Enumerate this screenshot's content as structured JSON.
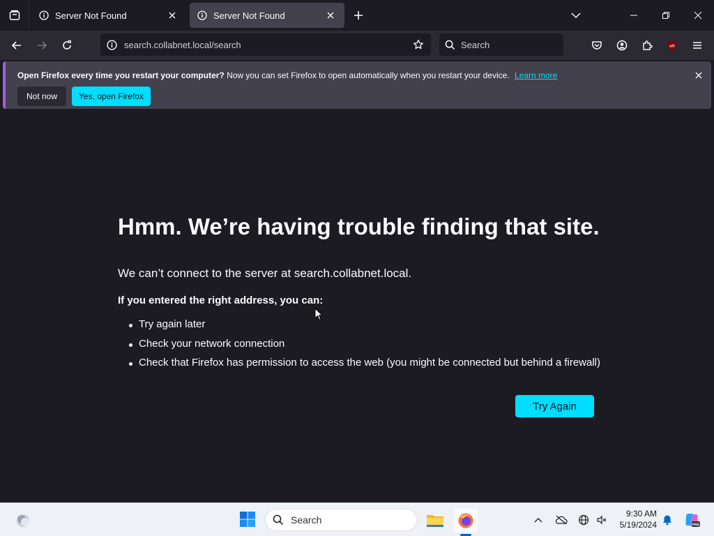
{
  "tabs": [
    {
      "title": "Server Not Found",
      "active": false
    },
    {
      "title": "Server Not Found",
      "active": true
    }
  ],
  "navbar": {
    "url": "search.collabnet.local/search",
    "search_placeholder": "Search"
  },
  "notification": {
    "bold_text": "Open Firefox every time you restart your computer?",
    "text": "Now you can set Firefox to open automatically when you restart your device.",
    "link": "Learn more",
    "not_now": "Not now",
    "yes": "Yes, open Firefox"
  },
  "error": {
    "title": "Hmm. We’re having trouble finding that site.",
    "description": "We can’t connect to the server at search.collabnet.local.",
    "subheading": "If you entered the right address, you can:",
    "suggestions": [
      "Try again later",
      "Check your network connection",
      "Check that Firefox has permission to access the web (you might be connected but behind a firewall)"
    ],
    "try_again": "Try Again"
  },
  "taskbar": {
    "search_placeholder": "Search",
    "time": "9:30 AM",
    "date": "5/19/2024"
  },
  "colors": {
    "accent": "#00ddff",
    "page_bg": "#1c1b22",
    "toolbar_bg": "#2b2a33",
    "notification_bg": "#42414d"
  }
}
